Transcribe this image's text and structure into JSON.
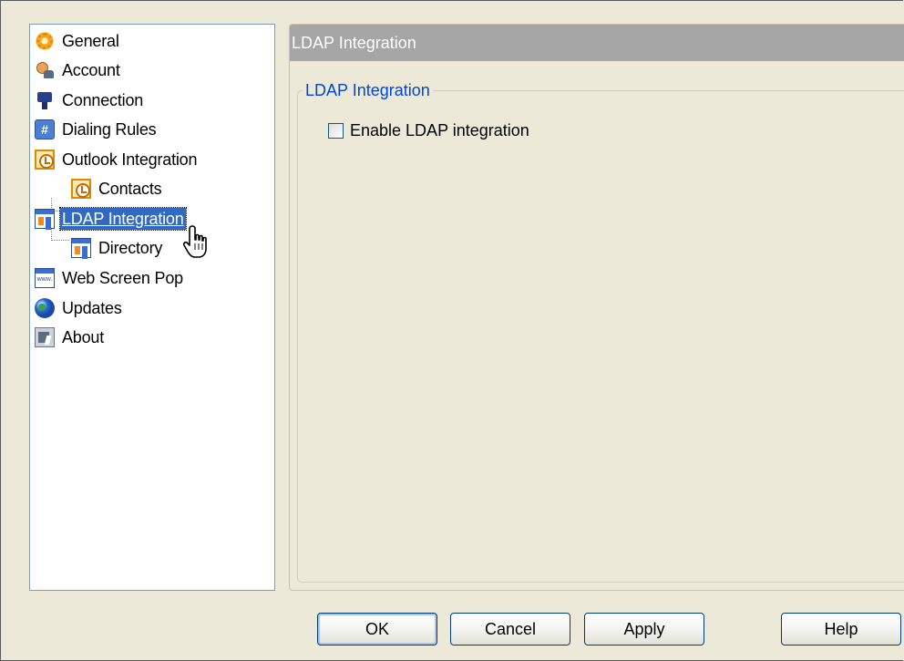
{
  "tree": {
    "items": [
      {
        "label": "General",
        "icon": "gear-icon"
      },
      {
        "label": "Account",
        "icon": "account-icon"
      },
      {
        "label": "Connection",
        "icon": "connection-icon"
      },
      {
        "label": "Dialing Rules",
        "icon": "dialing-rules-icon"
      },
      {
        "label": "Outlook Integration",
        "icon": "outlook-clock-icon"
      },
      {
        "label": "Contacts",
        "icon": "outlook-clock-icon"
      },
      {
        "label": "LDAP Integration",
        "icon": "ldap-directory-icon",
        "selected": true
      },
      {
        "label": "Directory",
        "icon": "ldap-directory-icon"
      },
      {
        "label": "Web Screen Pop",
        "icon": "web-page-icon"
      },
      {
        "label": "Updates",
        "icon": "globe-icon"
      },
      {
        "label": "About",
        "icon": "about-icon"
      }
    ],
    "dialing_glyph": "#",
    "web_glyph": "www."
  },
  "panel": {
    "header": "LDAP Integration",
    "group_title": "LDAP Integration",
    "checkbox_label": "Enable LDAP integration",
    "checkbox_checked": false
  },
  "buttons": {
    "ok": "OK",
    "cancel": "Cancel",
    "apply": "Apply",
    "help": "Help"
  },
  "colors": {
    "selection": "#316ac5",
    "header_bg": "#a6a6a6",
    "group_title": "#0046d5"
  }
}
